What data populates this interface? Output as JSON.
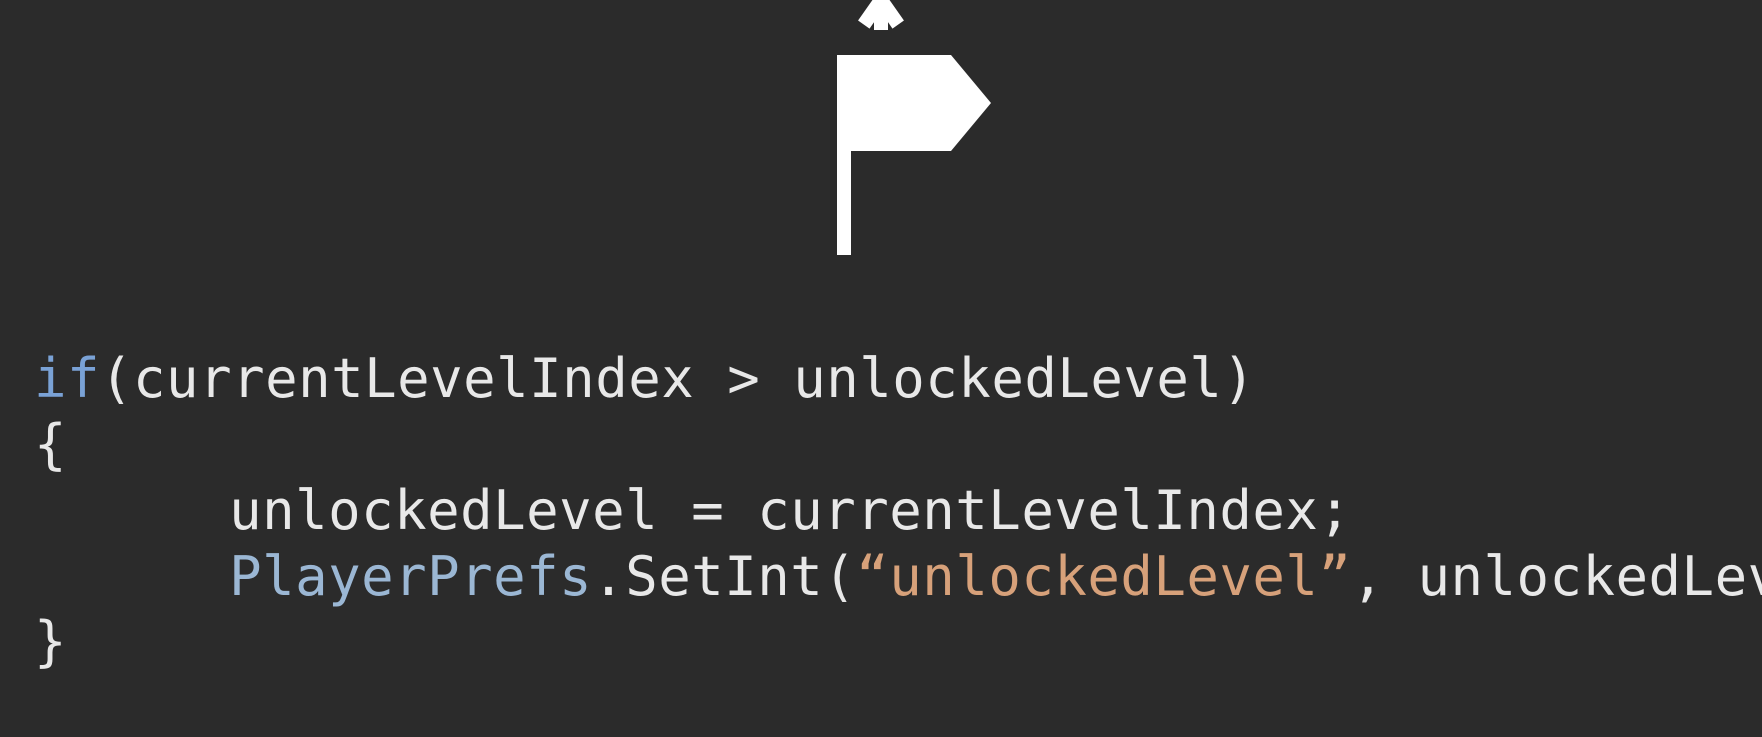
{
  "icon": {
    "name": "flag-icon"
  },
  "code": {
    "line1": {
      "kw_if": "if",
      "rest": "(currentLevelIndex > unlockedLevel)"
    },
    "line2": "{",
    "line3": "unlockedLevel = currentLevelIndex;",
    "line4": {
      "type": "PlayerPrefs",
      "mid1": ".SetInt(",
      "str": "“unlockedLevel”",
      "mid2": ", unlockedLevel);"
    },
    "line5": "}"
  }
}
